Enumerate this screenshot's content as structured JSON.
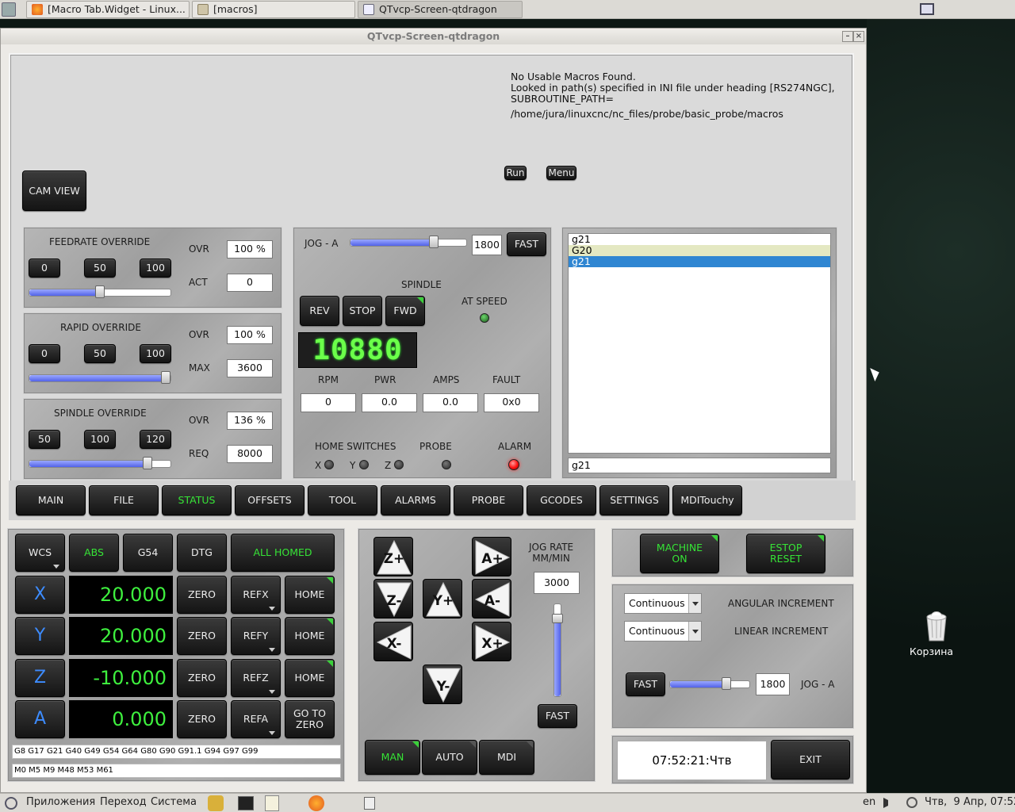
{
  "taskbar_top": {
    "tabs": [
      {
        "label": "[Macro Tab.Widget - Linux...",
        "icon": "firefox-icon"
      },
      {
        "label": "[macros]",
        "icon": "folder-icon"
      },
      {
        "label": "QTvcp-Screen-qtdragon",
        "icon": "window-icon"
      }
    ]
  },
  "window": {
    "title": "QTvcp-Screen-qtdragon",
    "minimize": "–",
    "close": "×"
  },
  "macros": {
    "message_lines": [
      "No Usable Macros Found.",
      "Looked in path(s) specified in INI file under heading [RS274NGC],",
      "SUBROUTINE_PATH=",
      "/home/jura/linuxcnc/nc_files/probe/basic_probe/macros"
    ],
    "run_label": "Run",
    "menu_label": "Menu",
    "cam_view_label": "CAM VIEW"
  },
  "feed": {
    "title": "FEEDRATE OVERRIDE",
    "buttons": [
      "0",
      "50",
      "100"
    ],
    "ovr_label": "OVR",
    "ovr_value": "100 %",
    "act_label": "ACT",
    "act_value": "0",
    "slider_fraction": 0.5
  },
  "rapid": {
    "title": "RAPID OVERRIDE",
    "buttons": [
      "0",
      "50",
      "100"
    ],
    "ovr_label": "OVR",
    "ovr_value": "100 %",
    "max_label": "MAX",
    "max_value": "3600",
    "slider_fraction": 1.0
  },
  "spindle_ovr": {
    "title": "SPINDLE OVERRIDE",
    "buttons": [
      "50",
      "100",
      "120"
    ],
    "ovr_label": "OVR",
    "ovr_value": "136 %",
    "req_label": "REQ",
    "req_value": "8000",
    "slider_fraction": 0.86
  },
  "spindle": {
    "jog_label": "JOG - A",
    "jog_value": "1800",
    "fast_label": "FAST",
    "jog_fraction": 0.74,
    "title": "SPINDLE",
    "rev": "REV",
    "stop": "STOP",
    "fwd": "FWD",
    "at_speed_label": "AT SPEED",
    "rpm_display": "10880",
    "rpm_label": "RPM",
    "rpm_value": "0",
    "pwr_label": "PWR",
    "pwr_value": "0.0",
    "amps_label": "AMPS",
    "amps_value": "0.0",
    "fault_label": "FAULT",
    "fault_value": "0x0",
    "home_switches_label": "HOME SWITCHES",
    "x": "X",
    "y": "Y",
    "z": "Z",
    "probe_label": "PROBE",
    "alarm_label": "ALARM"
  },
  "mdi": {
    "history": [
      "g21",
      "G20",
      "g21"
    ],
    "input_value": "g21"
  },
  "tabs": [
    "MAIN",
    "FILE",
    "STATUS",
    "OFFSETS",
    "TOOL",
    "ALARMS",
    "PROBE",
    "GCODES",
    "SETTINGS",
    "MDITouchy"
  ],
  "active_tab": "STATUS",
  "dro": {
    "wcs": "WCS",
    "abs": "ABS",
    "g54": "G54",
    "dtg": "DTG",
    "all_homed": "ALL HOMED",
    "axes": [
      {
        "axis": "X",
        "value": "20.000",
        "zero": "ZERO",
        "ref": "REFX",
        "home": "HOME"
      },
      {
        "axis": "Y",
        "value": "20.000",
        "zero": "ZERO",
        "ref": "REFY",
        "home": "HOME"
      },
      {
        "axis": "Z",
        "value": "-10.000",
        "zero": "ZERO",
        "ref": "REFZ",
        "home": "HOME"
      },
      {
        "axis": "A",
        "value": "0.000",
        "zero": "ZERO",
        "ref": "REFA",
        "home": "GO TO ZERO"
      }
    ],
    "gcodes": "G8 G17 G21 G40 G49 G54 G64 G80 G90 G91.1 G94 G97 G99",
    "mcodes": "M0 M5 M9 M48 M53 M61"
  },
  "jogpad": {
    "jog_rate_label": "JOG RATE\nMM/MIN",
    "jog_rate_value": "3000",
    "jog_rate_fraction": 0.9,
    "fast_label": "FAST",
    "buttons": [
      "Z+",
      "Z-",
      "Y+",
      "A+",
      "A-",
      "X-",
      "X+",
      "Y-"
    ],
    "man": "MAN",
    "auto": "AUTO",
    "mdi": "MDI"
  },
  "machine": {
    "machine_on": "MACHINE\nON",
    "estop_reset": "ESTOP\nRESET",
    "angular_combo": "Continuous",
    "angular_label": "ANGULAR INCREMENT",
    "linear_combo": "Continuous",
    "linear_label": "LINEAR INCREMENT",
    "fast_label": "FAST",
    "jog_value": "1800",
    "jog_label": "JOG - A",
    "jog_fraction": 0.74,
    "clock": "07:52:21:Чтв",
    "exit": "EXIT"
  },
  "desktop": {
    "trash_label": "Корзина"
  },
  "taskbar_bottom": {
    "menu_apps": "Приложения",
    "menu_go": "Переход",
    "menu_system": "Система",
    "lang": "en",
    "datetime": "Чтв,  9 Апр, 07:52"
  },
  "colors": {
    "accent_green": "#36e436",
    "axis_blue": "#3d8cff",
    "selection_blue": "#2f86d2",
    "selection_yellow": "#e4e8c2",
    "alarm_red": "#ff1010"
  }
}
